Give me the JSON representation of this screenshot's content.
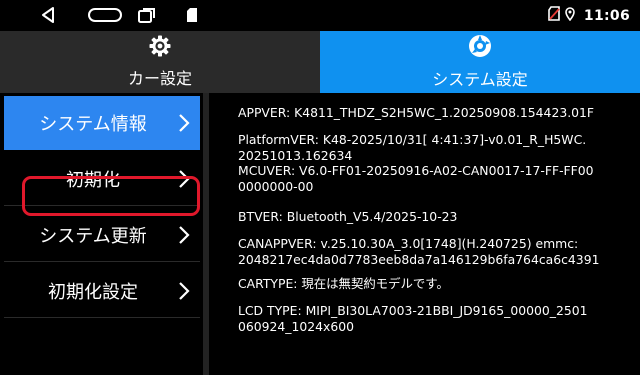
{
  "status_bar": {
    "time": "11:06",
    "icons": [
      "back-icon",
      "home-icon",
      "recent-apps-icon",
      "sd-card-icon",
      "no-sim-icon",
      "location-icon"
    ]
  },
  "tabs": [
    {
      "label": "カー設定",
      "icon": "gear-icon",
      "active": false
    },
    {
      "label": "システム設定",
      "icon": "system-settings-icon",
      "active": true
    }
  ],
  "sidebar": {
    "items": [
      {
        "label": "システム情報",
        "active": true
      },
      {
        "label": "初期化",
        "active": false
      },
      {
        "label": "システム更新",
        "active": false
      },
      {
        "label": "初期化設定",
        "active": false,
        "highlighted": true
      }
    ]
  },
  "info": {
    "appver": "APPVER: K4811_THDZ_S2H5WC_1.20250908.154423.01F",
    "platform_mcu": "PlatformVER: K48-2025/10/31[ 4:41:37]-v0.01_R_H5WC.\n20251013.162634\nMCUVER: V6.0-FF01-20250916-A02-CAN0017-17-FF-FF00\n0000000-00",
    "btver": "BTVER: Bluetooth_V5.4/2025-10-23",
    "canappver": "CANAPPVER: v.25.10.30A_3.0[1748](H.240725)  emmc:\n2048217ec4da0d7783eeb8da7a146129b6fa764ca6c4391",
    "cartype": "CARTYPE: 現在は無契約モデルです。",
    "lcd_type": "LCD TYPE: MIPI_BI30LA7003-21BBI_JD9165_00000_2501\n060924_1024x600"
  },
  "colors": {
    "active_tab": "#0f91f0",
    "active_menu": "#2d86f0",
    "inactive_tab": "#2a2a2a",
    "highlight_border": "#e0182b"
  }
}
